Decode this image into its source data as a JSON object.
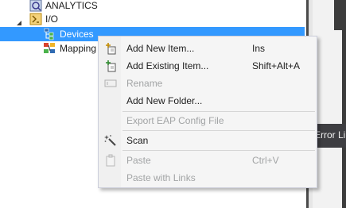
{
  "tree": {
    "items": [
      {
        "label": "ANALYTICS",
        "icon": "analytics-icon"
      },
      {
        "label": "I/O",
        "icon": "io-icon"
      },
      {
        "label": "Devices",
        "icon": "devices-icon",
        "selected": true
      },
      {
        "label": "Mapping",
        "icon": "mapping-icon"
      }
    ]
  },
  "right_panel": {
    "tab_label": "Error Li"
  },
  "context_menu": {
    "items": [
      {
        "label": "Add New Item...",
        "shortcut": "Ins",
        "enabled": true,
        "icon": "add-new-item-icon"
      },
      {
        "label": "Add Existing Item...",
        "shortcut": "Shift+Alt+A",
        "enabled": true,
        "icon": "add-existing-item-icon"
      },
      {
        "label": "Rename",
        "shortcut": "",
        "enabled": false,
        "icon": "rename-icon"
      },
      {
        "label": "Add New Folder...",
        "shortcut": "",
        "enabled": true,
        "icon": ""
      },
      {
        "label": "Export EAP Config File",
        "shortcut": "",
        "enabled": false,
        "icon": ""
      },
      {
        "label": "Scan",
        "shortcut": "",
        "enabled": true,
        "icon": "magic-wand-icon"
      },
      {
        "label": "Paste",
        "shortcut": "Ctrl+V",
        "enabled": false,
        "icon": "paste-icon"
      },
      {
        "label": "Paste with Links",
        "shortcut": "",
        "enabled": false,
        "icon": ""
      }
    ]
  },
  "colors": {
    "selection": "#3399ff",
    "menu_bg": "#f5f5f5",
    "disabled_text": "#a2a4a5"
  }
}
